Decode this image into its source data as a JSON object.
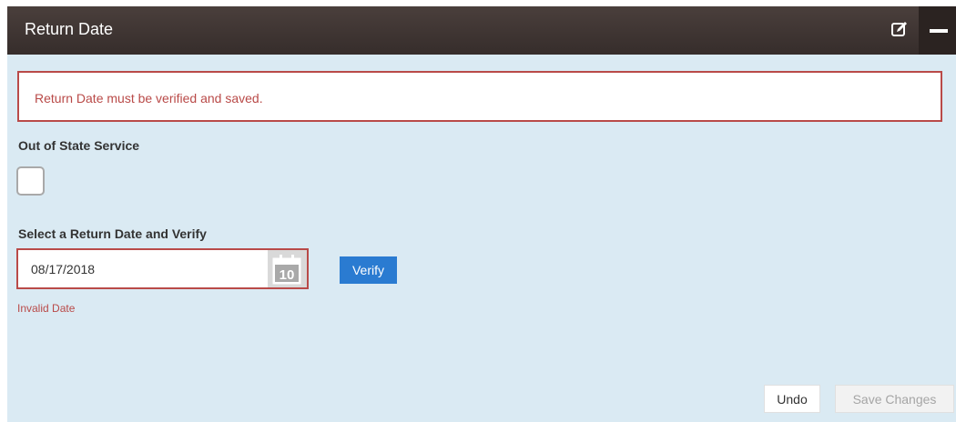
{
  "header": {
    "title": "Return Date",
    "edit_icon": "edit-icon",
    "minimize_icon": "minimize-icon"
  },
  "alert": {
    "message": "Return Date must be verified and saved."
  },
  "out_of_state": {
    "label": "Out of State Service",
    "checked": false
  },
  "return_date": {
    "label": "Select a Return Date and Verify",
    "value": "08/17/2018",
    "calendar_day": "10",
    "verify_label": "Verify",
    "error": "Invalid Date"
  },
  "footer": {
    "undo_label": "Undo",
    "save_label": "Save Changes"
  },
  "colors": {
    "header_bg": "#3b322f",
    "panel_bg": "#daeaf3",
    "error": "#b94a48",
    "primary": "#2a7bd1"
  }
}
